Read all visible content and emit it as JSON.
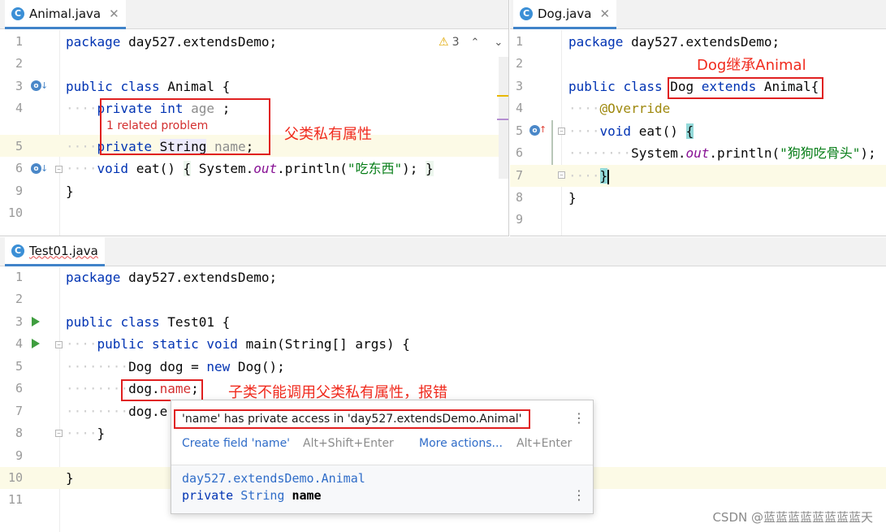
{
  "animal_pane": {
    "tab": {
      "icon": "java-class-icon",
      "filename": "Animal.java",
      "close": "✕"
    },
    "line_numbers": [
      "1",
      "2",
      "3",
      "4",
      "",
      "5",
      "6",
      "9",
      "10"
    ],
    "lines": {
      "l1": {
        "kw": "package",
        "rest": " day527.extendsDemo;"
      },
      "l3": {
        "kw1": "public",
        "kw2": "class",
        "name": "Animal",
        "brace": " {"
      },
      "l4": {
        "kw": "private",
        "type": "int",
        "field": "age",
        "end": " ;"
      },
      "problem": "1 related problem",
      "l5": {
        "kw": "private",
        "type": "String",
        "field": "name",
        "end": ";"
      },
      "l6": {
        "kw": "void",
        "method": "eat()",
        "b1": "{",
        "call1": "System.",
        "out": "out",
        "call2": ".println(",
        "str": "\"吃东西\"",
        "call3": ");",
        "b2": "}"
      },
      "l9": "}"
    },
    "warnings": {
      "icon": "warning-icon",
      "count": "3"
    },
    "annotation": "父类私有属性"
  },
  "dog_pane": {
    "tab": {
      "icon": "java-class-icon",
      "filename": "Dog.java",
      "close": "✕"
    },
    "line_numbers": [
      "1",
      "2",
      "3",
      "4",
      "5",
      "6",
      "7",
      "8",
      "9"
    ],
    "annotation": "Dog继承Animal",
    "lines": {
      "l1": {
        "kw": "package",
        "rest": " day527.extendsDemo;"
      },
      "l3": {
        "kw1": "public",
        "kw2": "class",
        "name": "Dog",
        "ext": "extends",
        "parent": "Animal",
        "brace": "{"
      },
      "l4": "@Override",
      "l5": {
        "kw": "void",
        "method": "eat()",
        "brace": "{"
      },
      "l6": {
        "call1": "System.",
        "out": "out",
        "call2": ".println(",
        "str": "\"狗狗吃骨头\"",
        "call3": ");"
      },
      "l7": "}",
      "l8": "}"
    }
  },
  "test_pane": {
    "tab": {
      "icon": "java-class-icon",
      "filename": "Test01.java"
    },
    "line_numbers": [
      "1",
      "2",
      "3",
      "4",
      "5",
      "6",
      "7",
      "8",
      "9",
      "10",
      "11"
    ],
    "lines": {
      "l1": {
        "kw": "package",
        "rest": " day527.extendsDemo;"
      },
      "l3": {
        "kw1": "public",
        "kw2": "class",
        "name": "Test01",
        "brace": " {"
      },
      "l4": {
        "kw1": "public",
        "kw2": "static",
        "kw3": "void",
        "rest": " main(String[] args) {"
      },
      "l5": {
        "t1": "Dog dog = ",
        "kw": "new",
        "t2": " Dog();"
      },
      "l6": {
        "pre": "dog.",
        "err": "name",
        "post": ";"
      },
      "l7": "dog.e",
      "l8": "}",
      "l10": "}"
    },
    "annotation": "子类不能调用父类私有属性，报错"
  },
  "error_popup": {
    "message": "'name' has private access in 'day527.extendsDemo.Animal'",
    "action1": "Create field 'name'",
    "shortcut1": "Alt+Shift+Enter",
    "action2": "More actions...",
    "shortcut2": "Alt+Enter",
    "declaring_class": "day527.extendsDemo.Animal",
    "decl_kw": "private",
    "decl_type": "String",
    "decl_name": "name",
    "menu": "⋮"
  },
  "watermark": "CSDN @蓝蓝蓝蓝蓝蓝蓝蓝天",
  "colors": {
    "keyword": "#0033b3",
    "string": "#067d17",
    "error": "#e02020",
    "annotation_text": "#f02a1d"
  }
}
